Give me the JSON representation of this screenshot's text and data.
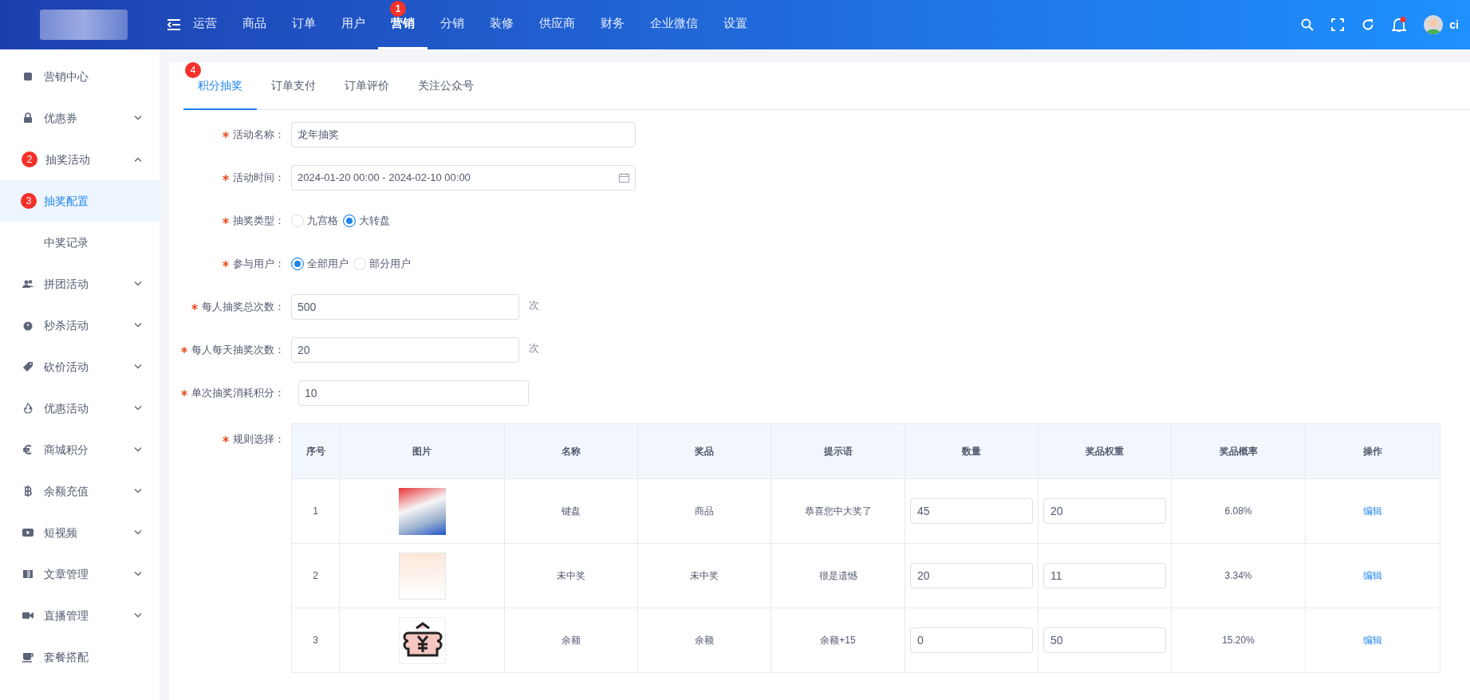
{
  "topbar": {
    "nav": [
      {
        "label": "运营",
        "selected": false
      },
      {
        "label": "商品",
        "selected": false
      },
      {
        "label": "订单",
        "selected": false
      },
      {
        "label": "用户",
        "selected": false
      },
      {
        "label": "营销",
        "selected": true,
        "marker": "1"
      },
      {
        "label": "分销",
        "selected": false
      },
      {
        "label": "装修",
        "selected": false
      },
      {
        "label": "供应商",
        "selected": false
      },
      {
        "label": "财务",
        "selected": false
      },
      {
        "label": "企业微信",
        "selected": false
      },
      {
        "label": "设置",
        "selected": false
      }
    ],
    "notifications_unread": true,
    "user": "ci"
  },
  "sidebar": {
    "items": [
      {
        "label": "营销中心",
        "kind": "link",
        "selected": false
      },
      {
        "label": "优惠券",
        "kind": "group",
        "expanded": false,
        "selected": false
      },
      {
        "label": "抽奖活动",
        "kind": "group",
        "expanded": true,
        "selected": false,
        "marker": "2",
        "children": [
          {
            "label": "抽奖配置",
            "selected": true,
            "marker": "3"
          },
          {
            "label": "中奖记录",
            "selected": false
          }
        ]
      },
      {
        "label": "拼团活动",
        "kind": "group",
        "expanded": false,
        "selected": false
      },
      {
        "label": "秒杀活动",
        "kind": "group",
        "expanded": false,
        "selected": false
      },
      {
        "label": "砍价活动",
        "kind": "group",
        "expanded": false,
        "selected": false
      },
      {
        "label": "优惠活动",
        "kind": "group",
        "expanded": false,
        "selected": false
      },
      {
        "label": "商城积分",
        "kind": "group",
        "expanded": false,
        "selected": false
      },
      {
        "label": "余额充值",
        "kind": "group",
        "expanded": false,
        "selected": false
      },
      {
        "label": "短视频",
        "kind": "group",
        "expanded": false,
        "selected": false
      },
      {
        "label": "文章管理",
        "kind": "group",
        "expanded": false,
        "selected": false
      },
      {
        "label": "直播管理",
        "kind": "group",
        "expanded": false,
        "selected": false
      },
      {
        "label": "套餐搭配",
        "kind": "link",
        "selected": false
      }
    ]
  },
  "tabs": [
    {
      "label": "积分抽奖",
      "selected": true,
      "marker": "4"
    },
    {
      "label": "订单支付",
      "selected": false
    },
    {
      "label": "订单评价",
      "selected": false
    },
    {
      "label": "关注公众号",
      "selected": false
    }
  ],
  "form": [
    {
      "kind": "text",
      "label": "活动名称：",
      "required": true,
      "value": "龙年抽奖"
    },
    {
      "kind": "daterange",
      "label": "活动时间：",
      "required": true,
      "value": "2024-01-20 00:00 - 2024-02-10 00:00"
    },
    {
      "kind": "radio",
      "label": "抽奖类型：",
      "required": true,
      "options": [
        {
          "label": "九宫格",
          "selected": false
        },
        {
          "label": "大转盘",
          "selected": true
        }
      ]
    },
    {
      "kind": "radio",
      "label": "参与用户：",
      "required": true,
      "options": [
        {
          "label": "全部用户",
          "selected": true
        },
        {
          "label": "部分用户",
          "selected": false
        }
      ]
    },
    {
      "kind": "number",
      "label": "每人抽奖总次数：",
      "required": true,
      "value": "500",
      "suffix": "次"
    },
    {
      "kind": "number",
      "label": "每人每天抽奖次数：",
      "required": true,
      "value": "20",
      "suffix": "次"
    },
    {
      "kind": "number",
      "label": "单次抽奖消耗积分：",
      "required": true,
      "value": "10"
    },
    {
      "kind": "table",
      "label": "规则选择：",
      "required": true
    }
  ],
  "prize_table": {
    "columns": [
      "序号",
      "图片",
      "名称",
      "奖品",
      "提示语",
      "数量",
      "奖品权重",
      "奖品概率",
      "操作"
    ],
    "rows": [
      {
        "index": "1",
        "kind": "poster",
        "name": "键盘",
        "prize": "商品",
        "message": "恭喜您中大奖了",
        "quantity": "45",
        "weight": "20",
        "probability": "6.08%",
        "action": "编辑"
      },
      {
        "index": "2",
        "kind": "card",
        "name": "未中奖",
        "prize": "未中奖",
        "message": "很是遗憾",
        "quantity": "20",
        "weight": "11",
        "probability": "3.34%",
        "action": "编辑"
      },
      {
        "index": "3",
        "kind": "icon",
        "name": "余额",
        "prize": "余额",
        "message": "余额+15",
        "quantity": "0",
        "weight": "50",
        "probability": "15.20%",
        "action": "编辑"
      }
    ]
  }
}
